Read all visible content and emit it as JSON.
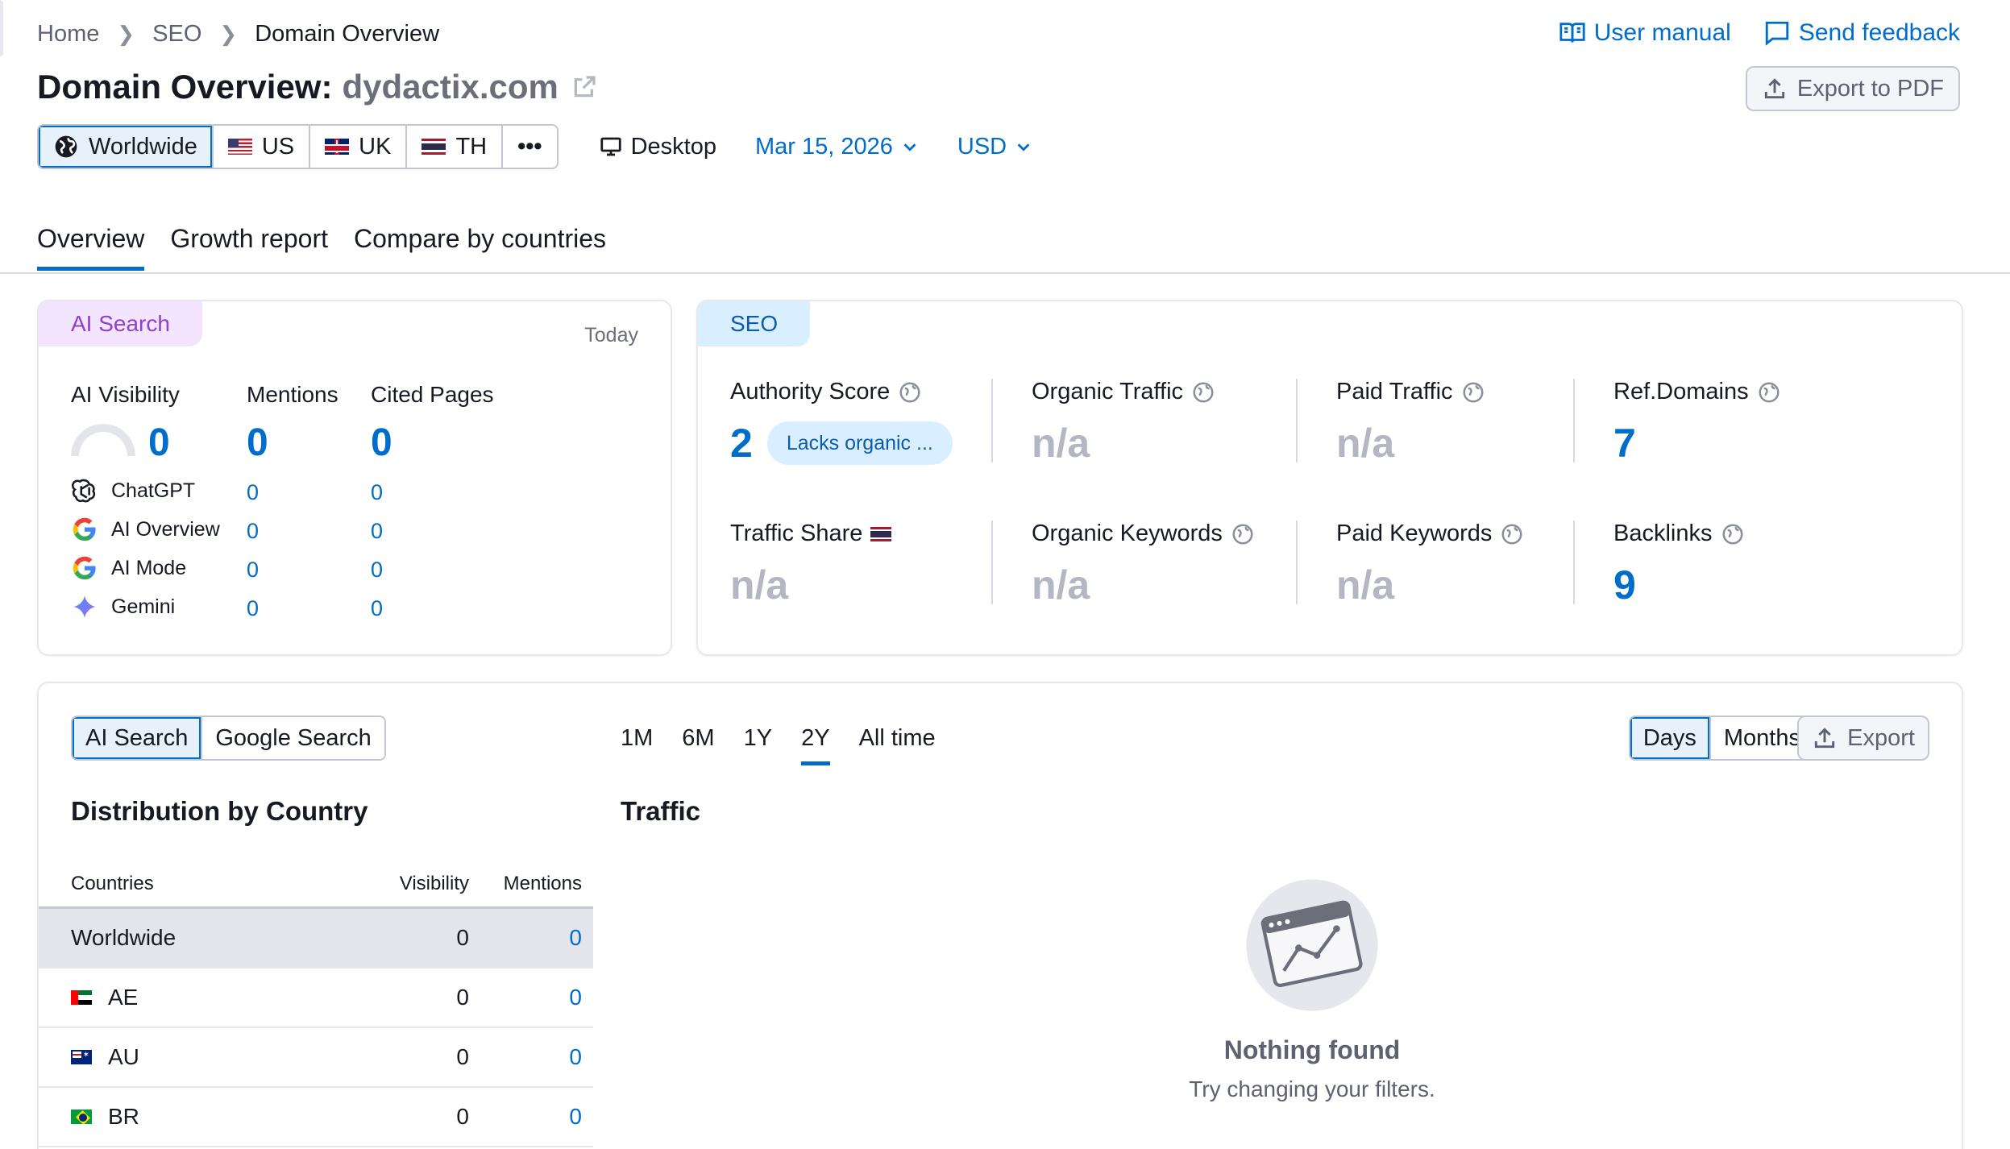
{
  "breadcrumb": {
    "home": "Home",
    "seo": "SEO",
    "current": "Domain Overview"
  },
  "links": {
    "manual": "User manual",
    "feedback": "Send feedback"
  },
  "title": {
    "prefix": "Domain Overview:",
    "domain": "dydactix.com"
  },
  "export_pdf": "Export to PDF",
  "databases": [
    {
      "label": "Worldwide",
      "active": true
    },
    {
      "label": "US"
    },
    {
      "label": "UK"
    },
    {
      "label": "TH"
    }
  ],
  "more_label": "•••",
  "device": "Desktop",
  "date": "Mar 15, 2026",
  "currency": "USD",
  "tabs": [
    "Overview",
    "Growth report",
    "Compare by countries"
  ],
  "ai_card": {
    "tag": "AI Search",
    "date_label": "Today",
    "cols": {
      "visibility": "AI Visibility",
      "mentions": "Mentions",
      "cited": "Cited Pages"
    },
    "totals": {
      "visibility": "0",
      "mentions": "0",
      "cited": "0"
    },
    "rows": [
      {
        "name": "ChatGPT",
        "mentions": "0",
        "cited": "0",
        "icon": "chatgpt-icon"
      },
      {
        "name": "AI Overview",
        "mentions": "0",
        "cited": "0",
        "icon": "google-icon"
      },
      {
        "name": "AI Mode",
        "mentions": "0",
        "cited": "0",
        "icon": "google-icon"
      },
      {
        "name": "Gemini",
        "mentions": "0",
        "cited": "0",
        "icon": "gemini-icon"
      }
    ]
  },
  "seo_card": {
    "tag": "SEO",
    "authority": {
      "label": "Authority Score",
      "value": "2",
      "pill": "Lacks organic ..."
    },
    "organic_traffic": {
      "label": "Organic Traffic",
      "value": "n/a"
    },
    "paid_traffic": {
      "label": "Paid Traffic",
      "value": "n/a"
    },
    "ref_domains": {
      "label": "Ref.Domains",
      "value": "7"
    },
    "traffic_share": {
      "label": "Traffic Share",
      "value": "n/a"
    },
    "organic_keywords": {
      "label": "Organic Keywords",
      "value": "n/a"
    },
    "paid_keywords": {
      "label": "Paid Keywords",
      "value": "n/a"
    },
    "backlinks": {
      "label": "Backlinks",
      "value": "9"
    }
  },
  "bottom": {
    "source_toggle": [
      "AI Search",
      "Google Search"
    ],
    "ranges": [
      "1M",
      "6M",
      "1Y",
      "2Y",
      "All time"
    ],
    "active_range": "2Y",
    "granularity": [
      "Days",
      "Months"
    ],
    "export": "Export",
    "distribution_title": "Distribution by Country",
    "traffic_title": "Traffic",
    "table": {
      "headers": {
        "country": "Countries",
        "visibility": "Visibility",
        "mentions": "Mentions"
      },
      "rows": [
        {
          "country": "Worldwide",
          "visibility": "0",
          "mentions": "0"
        },
        {
          "country": "AE",
          "visibility": "0",
          "mentions": "0"
        },
        {
          "country": "AU",
          "visibility": "0",
          "mentions": "0"
        },
        {
          "country": "BR",
          "visibility": "0",
          "mentions": "0"
        }
      ]
    },
    "empty": {
      "title": "Nothing found",
      "subtitle": "Try changing your filters."
    }
  },
  "colors": {
    "accent": "#006dca",
    "ai_tag": "#f3e5ff",
    "seo_tag": "#d9efff",
    "muted": "#b4b7c1"
  }
}
